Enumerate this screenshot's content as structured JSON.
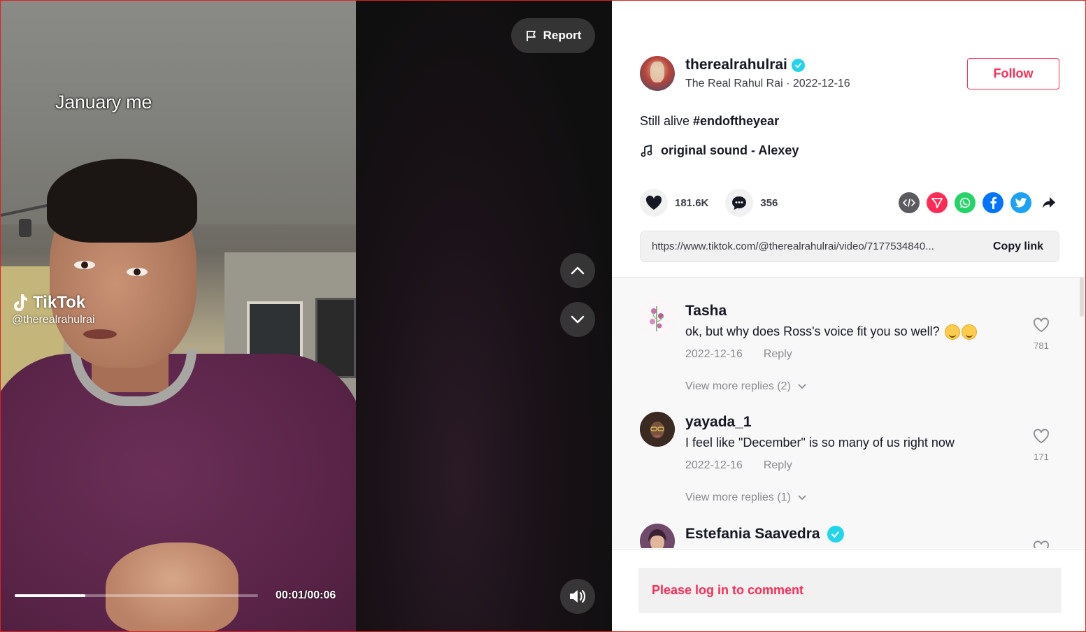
{
  "video": {
    "caption_overlay": "January me",
    "watermark_brand": "TikTok",
    "watermark_user": "@therealrahulrai",
    "current_time": "00:01/00:06",
    "progress": 0.29,
    "report_label": "Report"
  },
  "author": {
    "username": "therealrahulrai",
    "subtitle": "The Real Rahul Rai · 2022-12-16",
    "follow_label": "Follow"
  },
  "post": {
    "description": "Still alive ",
    "hashtag": "#endoftheyear",
    "music": "original sound - Alexey",
    "likes": "181.6K",
    "comments": "356",
    "link": "https://www.tiktok.com/@therealrahulrai/video/7177534840...",
    "copy_link_label": "Copy link"
  },
  "share_icons": [
    {
      "name": "embed-icon",
      "color": "#5a5a5f"
    },
    {
      "name": "send-to-friends-icon",
      "color": "#fe2c55"
    },
    {
      "name": "whatsapp-icon",
      "color": "#25d366"
    },
    {
      "name": "facebook-icon",
      "color": "#0075fa"
    },
    {
      "name": "twitter-icon",
      "color": "#1da1f2"
    },
    {
      "name": "share-arrow-icon",
      "color": "#161823"
    }
  ],
  "comments": [
    {
      "name": "Tasha",
      "text": "ok, but why does Ross's voice fit you so well? ",
      "date": "2022-12-16",
      "reply": "Reply",
      "likes": "781",
      "replies": "View more replies (2)"
    },
    {
      "name": "yayada_1",
      "text": "I feel like \"December\" is so many of us right now",
      "date": "2022-12-16",
      "reply": "Reply",
      "likes": "171",
      "replies": "View more replies (1)"
    },
    {
      "name": "Estefania Saavedra"
    }
  ],
  "login_prompt": "Please log in to comment",
  "colors": {
    "brand": "#fe2c55",
    "verified": "#20d5ec"
  }
}
